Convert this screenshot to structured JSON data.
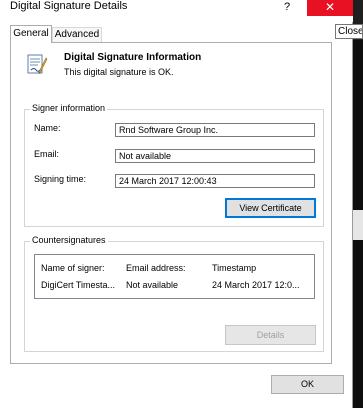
{
  "window": {
    "title": "Digital Signature Details",
    "help_label": "?",
    "close_label": "✕",
    "close_tooltip": "Close"
  },
  "tabs": [
    {
      "label": "General",
      "active": true
    },
    {
      "label": "Advanced",
      "active": false
    }
  ],
  "info": {
    "icon": "certificate-icon",
    "title": "Digital Signature Information",
    "subtitle": "This digital signature is OK."
  },
  "signer": {
    "legend": "Signer information",
    "name_label": "Name:",
    "name_value": "Rnd Software Group Inc.",
    "email_label": "Email:",
    "email_value": "Not available",
    "time_label": "Signing time:",
    "time_value": "24 March 2017 12:00:43",
    "view_button": "View Certificate"
  },
  "countersignatures": {
    "legend": "Countersignatures",
    "columns": [
      "Name of signer:",
      "Email address:",
      "Timestamp"
    ],
    "rows": [
      [
        "DigiCert Timesta...",
        "Not available",
        "24 March 2017 12:0..."
      ]
    ],
    "details_button": "Details"
  },
  "footer": {
    "ok_button": "OK"
  },
  "colors": {
    "close_red": "#e81123",
    "focus_blue": "#0078d7"
  }
}
